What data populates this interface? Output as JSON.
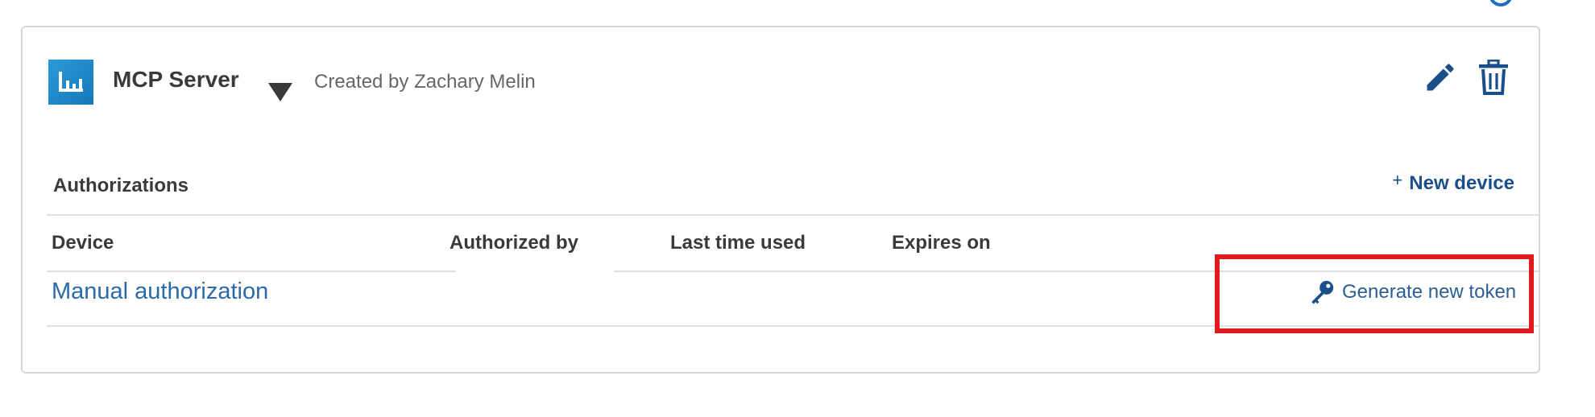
{
  "app": {
    "name": "MCP Server",
    "created_by": "Created by Zachary Melin",
    "logo_color": "#1f8fd0"
  },
  "actions": {
    "edit_icon": "pencil-icon",
    "delete_icon": "trash-icon",
    "dropdown_icon": "caret-down-icon"
  },
  "authorizations": {
    "title": "Authorizations",
    "new_device_plus": "+",
    "new_device_label": "New device",
    "columns": [
      "Device",
      "Authorized by",
      "Last time used",
      "Expires on"
    ],
    "rows": [
      {
        "device": "Manual authorization",
        "authorized_by": "",
        "last_time_used": "",
        "expires_on": "",
        "action_label": "Generate new token",
        "action_icon": "key-icon"
      }
    ]
  },
  "colors": {
    "link": "#2b6aa8",
    "accent": "#1a4f8a",
    "highlight": "#e01b1b"
  }
}
